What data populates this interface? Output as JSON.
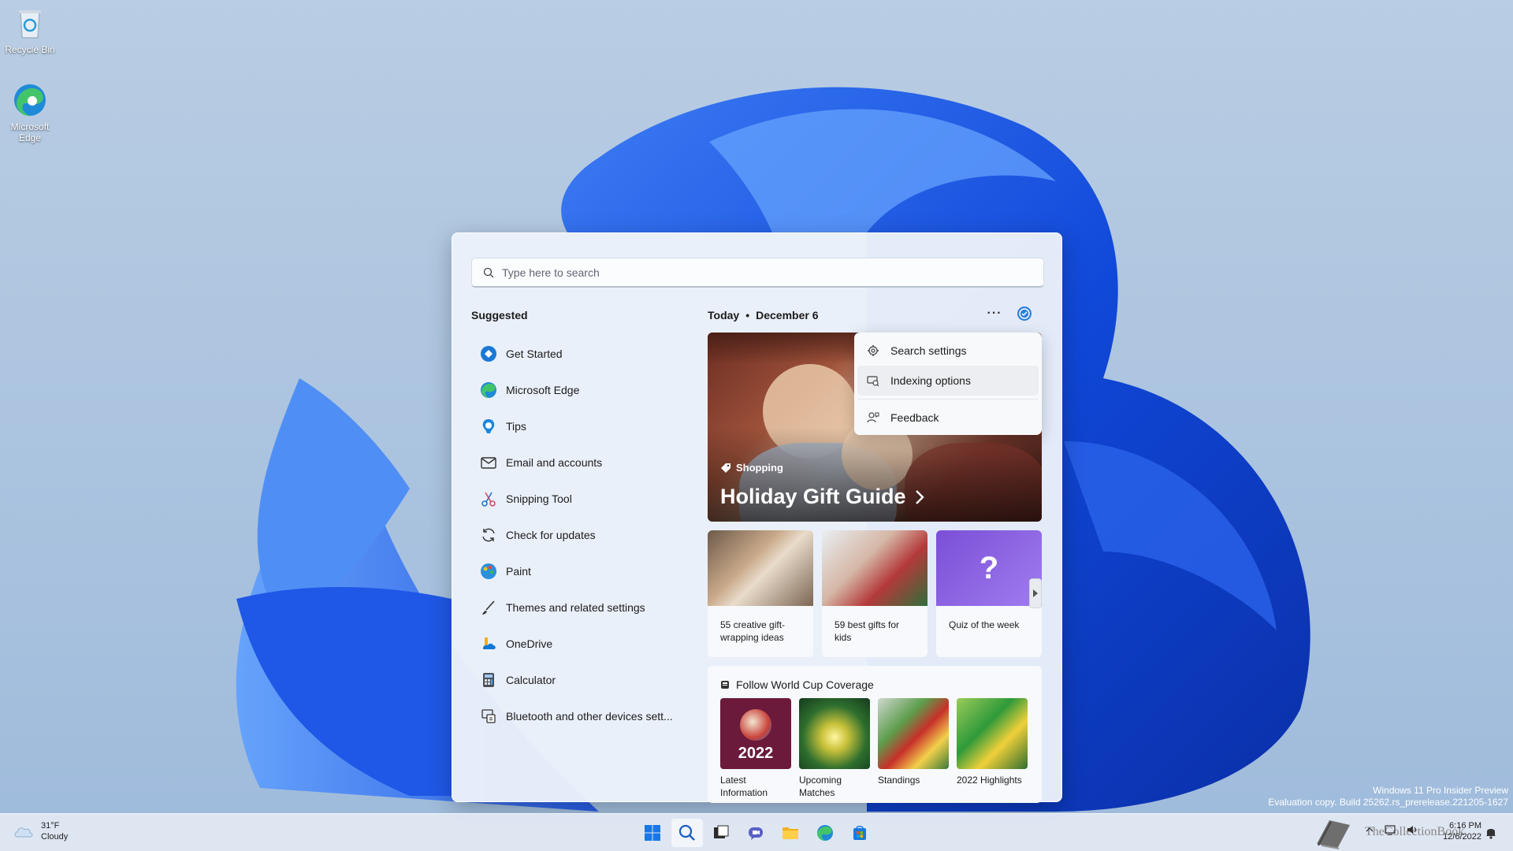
{
  "desktop": {
    "icons": [
      {
        "label": "Recycle Bin"
      },
      {
        "label": "Microsoft Edge"
      }
    ]
  },
  "search_panel": {
    "search": {
      "placeholder": "Type here to search"
    },
    "suggested_title": "Suggested",
    "suggested": [
      {
        "label": "Get Started",
        "icon": "get-started-icon"
      },
      {
        "label": "Microsoft Edge",
        "icon": "edge-icon"
      },
      {
        "label": "Tips",
        "icon": "tips-icon"
      },
      {
        "label": "Email and accounts",
        "icon": "mail-icon"
      },
      {
        "label": "Snipping Tool",
        "icon": "scissors-icon"
      },
      {
        "label": "Check for updates",
        "icon": "refresh-icon"
      },
      {
        "label": "Paint",
        "icon": "paint-icon"
      },
      {
        "label": "Themes and related settings",
        "icon": "brush-icon"
      },
      {
        "label": "OneDrive",
        "icon": "onedrive-icon"
      },
      {
        "label": "Calculator",
        "icon": "calculator-icon"
      },
      {
        "label": "Bluetooth and other devices sett...",
        "icon": "bluetooth-devices-icon"
      }
    ],
    "today": {
      "label": "Today",
      "separator": "•",
      "date": "December 6"
    },
    "more_button_label": "···",
    "hero": {
      "tag": "Shopping",
      "title": "Holiday Gift Guide"
    },
    "cards": [
      {
        "label": "55 creative gift-wrapping ideas"
      },
      {
        "label": "59 best gifts for kids"
      },
      {
        "label": "Quiz of the week"
      }
    ],
    "world_cup": {
      "title": "Follow World Cup Coverage",
      "tiles": [
        {
          "label": "Latest Information",
          "badge": "2022"
        },
        {
          "label": "Upcoming Matches"
        },
        {
          "label": "Standings"
        },
        {
          "label": "2022 Highlights"
        }
      ]
    },
    "menu": [
      {
        "label": "Search settings",
        "icon": "gear-icon"
      },
      {
        "label": "Indexing options",
        "icon": "indexing-icon"
      },
      {
        "label": "Feedback",
        "icon": "feedback-icon"
      }
    ]
  },
  "watermark": {
    "line1": "Windows 11 Pro Insider Preview",
    "line2": "Evaluation copy. Build 25262.rs_prerelease.221205-1627"
  },
  "taskbar": {
    "weather": {
      "temp": "31°F",
      "condition": "Cloudy"
    },
    "clock": {
      "time": "6:16 PM",
      "date": "12/6/2022"
    },
    "brand_overlay": "TheCollectionBook"
  }
}
